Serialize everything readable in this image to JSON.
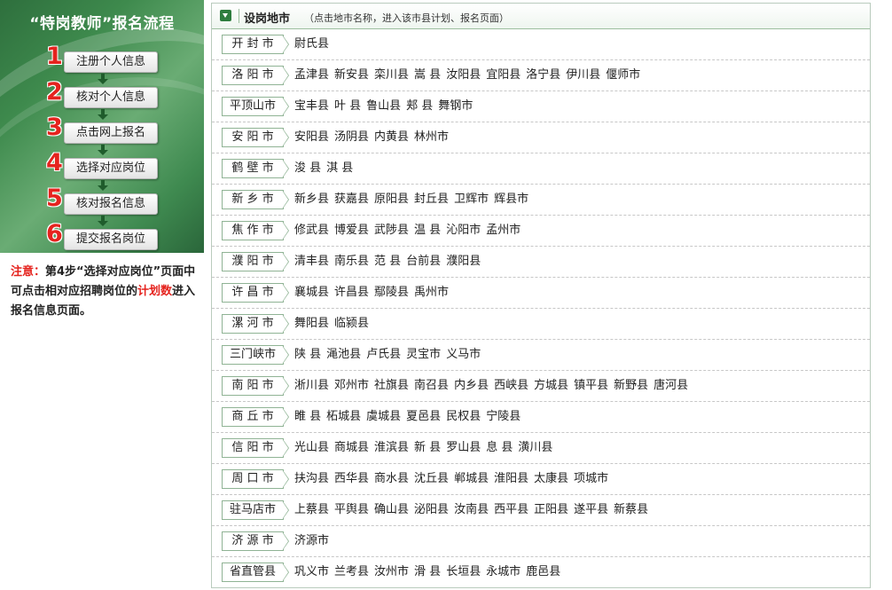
{
  "flow": {
    "title": "“特岗教师”报名流程",
    "steps": [
      {
        "num": "1",
        "label": "注册个人信息"
      },
      {
        "num": "2",
        "label": "核对个人信息"
      },
      {
        "num": "3",
        "label": "点击网上报名"
      },
      {
        "num": "4",
        "label": "选择对应岗位"
      },
      {
        "num": "5",
        "label": "核对报名信息"
      },
      {
        "num": "6",
        "label": "提交报名岗位"
      }
    ],
    "note": {
      "prefix": "注意：",
      "text1": "第4步“选择对应岗位”页面中可点击相对应招聘岗位的",
      "highlight": "计划数",
      "text2": "进入报名信息页面。"
    },
    "accent_color": "#e5231e",
    "panel_color": "#3e8a4d"
  },
  "header": {
    "title": "设岗地市",
    "hint": "（点击地市名称，进入该市县计划、报名页面）",
    "icon": "chevron-down-icon"
  },
  "cities": [
    {
      "name": "开 封 市",
      "counties": [
        "尉氏县"
      ]
    },
    {
      "name": "洛 阳 市",
      "counties": [
        "孟津县",
        "新安县",
        "栾川县",
        "嵩 县",
        "汝阳县",
        "宜阳县",
        "洛宁县",
        "伊川县",
        "偃师市"
      ]
    },
    {
      "name": "平顶山市",
      "counties": [
        "宝丰县",
        "叶 县",
        "鲁山县",
        "郏 县",
        "舞钢市"
      ]
    },
    {
      "name": "安 阳 市",
      "counties": [
        "安阳县",
        "汤阴县",
        "内黄县",
        "林州市"
      ]
    },
    {
      "name": "鹤 壁 市",
      "counties": [
        "浚 县",
        "淇 县"
      ]
    },
    {
      "name": "新 乡 市",
      "counties": [
        "新乡县",
        "获嘉县",
        "原阳县",
        "封丘县",
        "卫辉市",
        "辉县市"
      ]
    },
    {
      "name": "焦 作 市",
      "counties": [
        "修武县",
        "博爱县",
        "武陟县",
        "温 县",
        "沁阳市",
        "孟州市"
      ]
    },
    {
      "name": "濮 阳 市",
      "counties": [
        "清丰县",
        "南乐县",
        "范 县",
        "台前县",
        "濮阳县"
      ]
    },
    {
      "name": "许 昌 市",
      "counties": [
        "襄城县",
        "许昌县",
        "鄢陵县",
        "禹州市"
      ]
    },
    {
      "name": "漯 河 市",
      "counties": [
        "舞阳县",
        "临颍县"
      ]
    },
    {
      "name": "三门峡市",
      "counties": [
        "陕 县",
        "渑池县",
        "卢氏县",
        "灵宝市",
        "义马市"
      ]
    },
    {
      "name": "南 阳 市",
      "counties": [
        "淅川县",
        "邓州市",
        "社旗县",
        "南召县",
        "内乡县",
        "西峡县",
        "方城县",
        "镇平县",
        "新野县",
        "唐河县"
      ]
    },
    {
      "name": "商 丘 市",
      "counties": [
        "睢 县",
        "柘城县",
        "虞城县",
        "夏邑县",
        "民权县",
        "宁陵县"
      ]
    },
    {
      "name": "信 阳 市",
      "counties": [
        "光山县",
        "商城县",
        "淮滨县",
        "新 县",
        "罗山县",
        "息 县",
        "潢川县"
      ]
    },
    {
      "name": "周 口 市",
      "counties": [
        "扶沟县",
        "西华县",
        "商水县",
        "沈丘县",
        "郸城县",
        "淮阳县",
        "太康县",
        "项城市"
      ]
    },
    {
      "name": "驻马店市",
      "counties": [
        "上蔡县",
        "平舆县",
        "确山县",
        "泌阳县",
        "汝南县",
        "西平县",
        "正阳县",
        "遂平县",
        "新蔡县"
      ]
    },
    {
      "name": "济 源 市",
      "counties": [
        "济源市"
      ]
    },
    {
      "name": "省直管县",
      "counties": [
        "巩义市",
        "兰考县",
        "汝州市",
        "滑 县",
        "长垣县",
        "永城市",
        "鹿邑县"
      ]
    }
  ]
}
